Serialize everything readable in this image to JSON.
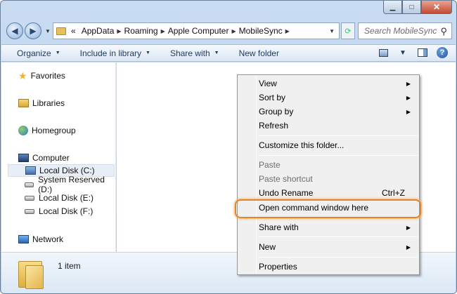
{
  "window": {
    "caption": {
      "minimize": "▁",
      "maximize": "□",
      "close": "✕"
    }
  },
  "nav": {
    "back_icon": "back-arrow-icon",
    "forward_icon": "forward-arrow-icon",
    "address": {
      "overflow": "«",
      "crumbs": [
        "AppData",
        "Roaming",
        "Apple Computer",
        "MobileSync"
      ]
    },
    "search_placeholder": "Search MobileSync"
  },
  "toolbar": {
    "organize": "Organize",
    "include": "Include in library",
    "share": "Share with",
    "new_folder": "New folder"
  },
  "sidebar": {
    "favorites": "Favorites",
    "libraries": "Libraries",
    "homegroup": "Homegroup",
    "computer": "Computer",
    "drives": [
      "Local Disk (C:)",
      "System Reserved (D:)",
      "Local Disk (E:)",
      "Local Disk (F:)"
    ],
    "network": "Network"
  },
  "status": {
    "count": "1 item"
  },
  "context_menu": {
    "view": "View",
    "sort_by": "Sort by",
    "group_by": "Group by",
    "refresh": "Refresh",
    "customize": "Customize this folder...",
    "paste": "Paste",
    "paste_shortcut": "Paste shortcut",
    "undo_rename": "Undo Rename",
    "undo_shortcut": "Ctrl+Z",
    "open_cmd": "Open command window here",
    "share_with": "Share with",
    "new": "New",
    "properties": "Properties"
  },
  "colors": {
    "highlight_ring": "#e0872a",
    "window_frame": "#b5cde9"
  }
}
